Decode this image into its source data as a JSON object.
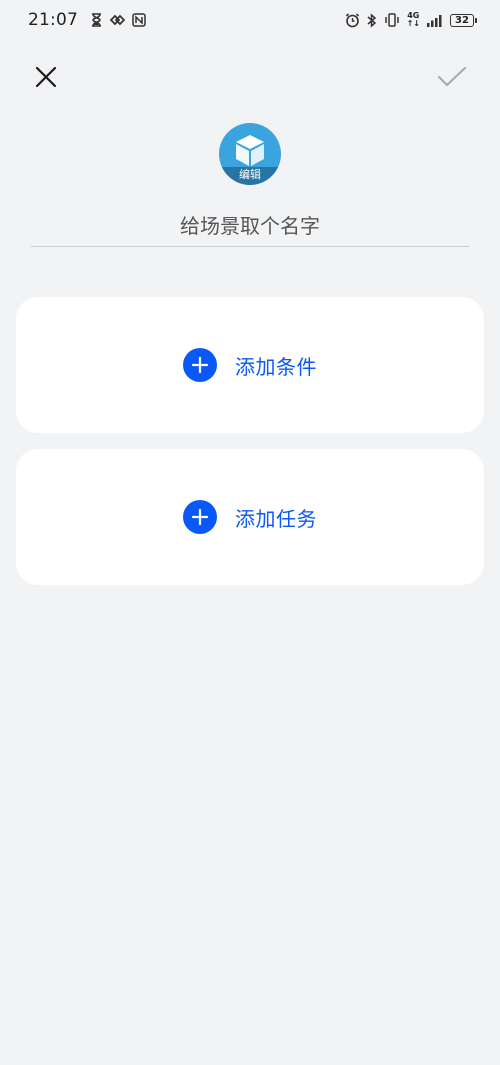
{
  "status_bar": {
    "time": "21:07",
    "network_type_top": "4G",
    "network_type_bottom": "↑↓",
    "battery_level": "32"
  },
  "toolbar": {
    "close_icon": "close-icon",
    "confirm_icon": "check-icon"
  },
  "scene_icon": {
    "edit_label": "编辑",
    "color": "#3aa4df"
  },
  "name_input": {
    "placeholder": "给场景取个名字",
    "value": ""
  },
  "cards": {
    "add_condition_label": "添加条件",
    "add_task_label": "添加任务"
  },
  "colors": {
    "accent": "#0a59f7",
    "background": "#f2f3f5",
    "card": "#ffffff"
  }
}
